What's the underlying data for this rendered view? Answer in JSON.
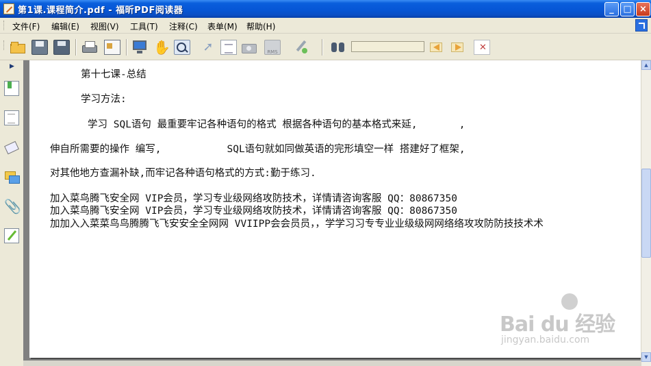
{
  "window": {
    "title": "第1课.课程简介.pdf - 福昕PDF阅读器",
    "minimize": "_",
    "maximize": "□",
    "close": "×"
  },
  "menu": {
    "items": [
      {
        "label": "文件(F)"
      },
      {
        "label": "编辑(E)"
      },
      {
        "label": "视图(V)"
      },
      {
        "label": "工具(T)"
      },
      {
        "label": "注释(C)"
      },
      {
        "label": "表单(M)"
      },
      {
        "label": "帮助(H)"
      }
    ]
  },
  "toolbar": {
    "icons": [
      "open-icon",
      "save-icon",
      "save-all-icon",
      "print-icon",
      "properties-icon",
      "fullscreen-icon",
      "hand-icon",
      "zoom-icon",
      "select-icon",
      "text-select-icon",
      "snapshot-icon",
      "rms-icon",
      "sign-icon",
      "find-icon",
      "find-prev-icon",
      "find-next-icon",
      "clear-find-icon"
    ],
    "rms_label": "RMS",
    "search_value": ""
  },
  "sidebar": {
    "toggle": "▶",
    "icons": [
      "bookmarks-icon",
      "pages-icon",
      "layers-icon",
      "comments-icon",
      "attachments-icon",
      "signatures-icon"
    ]
  },
  "document": {
    "lines": [
      "第十七课-总结",
      "学习方法:",
      "学习 SQL语句 最重要牢记各种语句的格式 根据各种语句的基本格式来延,       ,",
      "伸自所需要的操作 编写,           SQL语句就如同做英语的完形填空一样 搭建好了框架,",
      "对其他地方查漏补缺,而牢记各种语句格式的方式:勤于练习.",
      "加入菜鸟腾飞安全网 VIP会员，学习专业级网络攻防技术，详情请咨询客服 QQ：80867350",
      "加入菜鸟腾飞安全网 VIP会员，学习专业级网络攻防技术，详情请咨询客服 QQ：80867350",
      "加加入入菜菜鸟鸟腾腾飞飞安安全全网网 VVIIPP会会员员，，学学习习专专业业级级网网络络攻攻防防技技术术"
    ]
  },
  "watermark": {
    "logo": "Bai du 经验",
    "url": "jingyan.baidu.com"
  },
  "scrollbar": {
    "up": "▲",
    "down": "▼",
    "position": 0.36
  }
}
